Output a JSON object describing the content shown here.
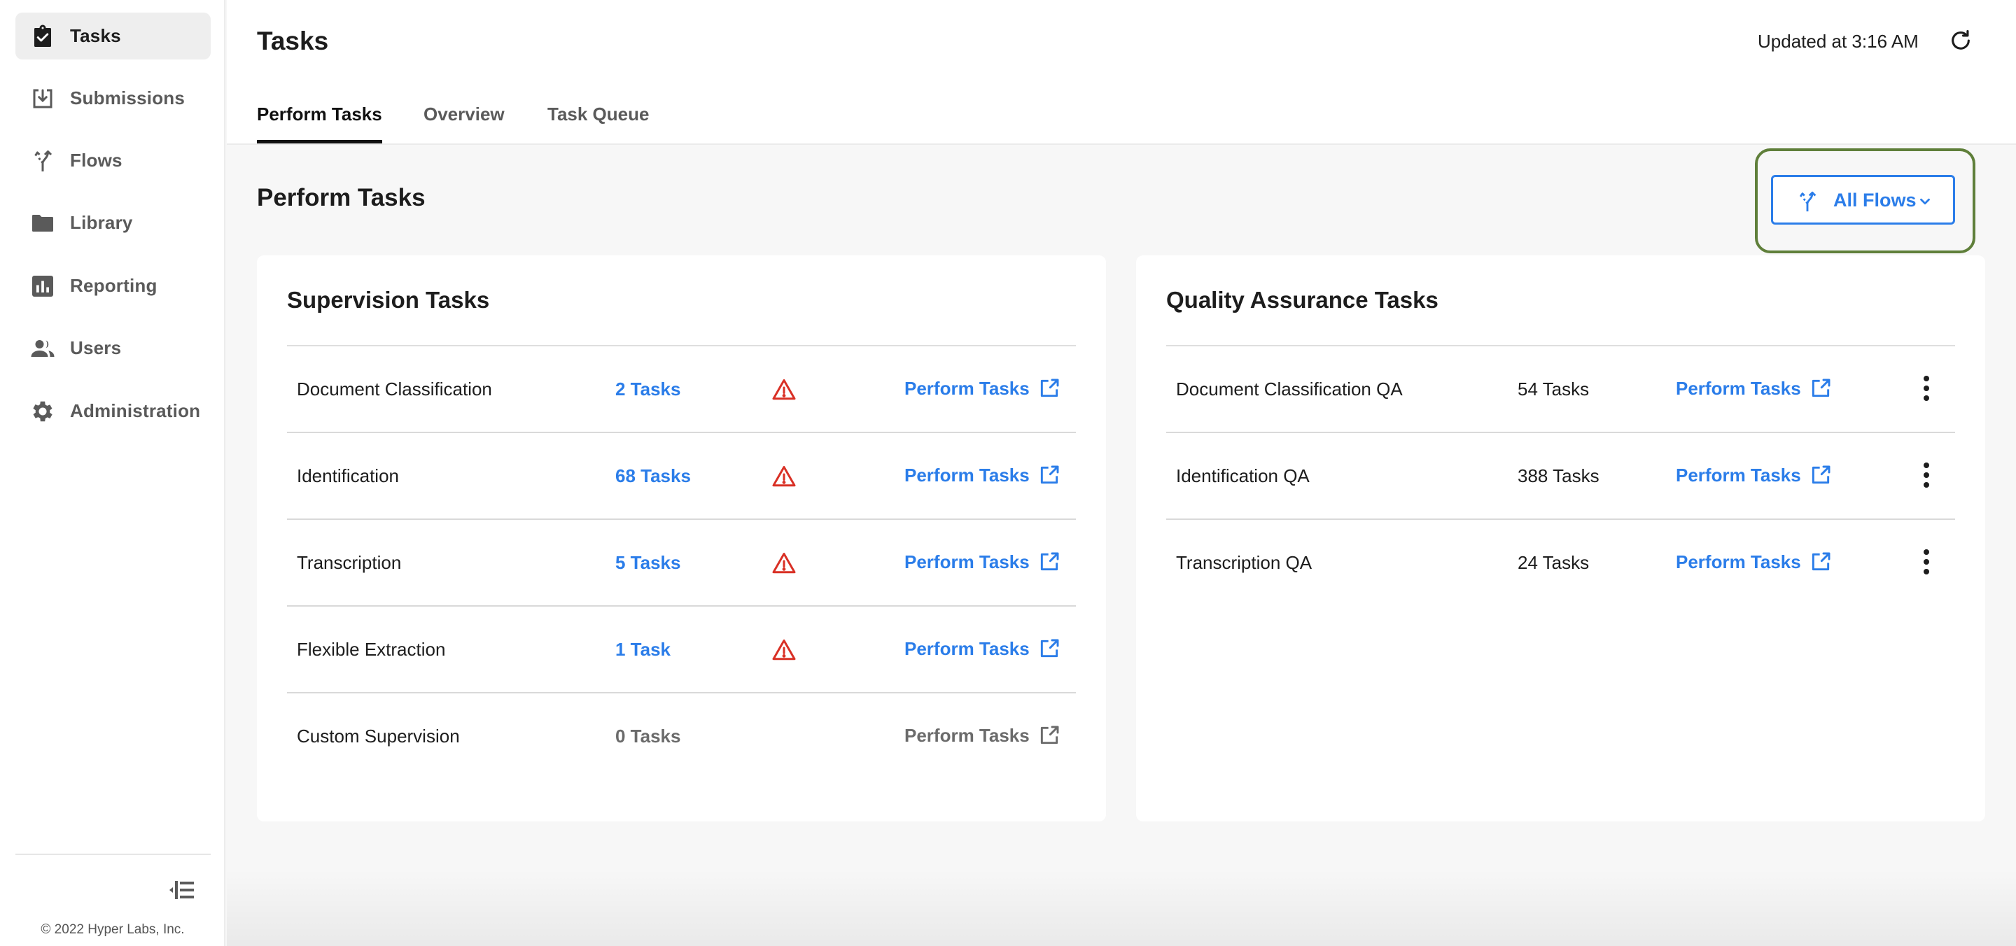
{
  "sidebar": {
    "items": [
      {
        "label": "Tasks",
        "icon": "clipboard-check-icon",
        "active": true
      },
      {
        "label": "Submissions",
        "icon": "inbox-download-icon",
        "active": false
      },
      {
        "label": "Flows",
        "icon": "flow-split-icon",
        "active": false
      },
      {
        "label": "Library",
        "icon": "folder-icon",
        "active": false
      },
      {
        "label": "Reporting",
        "icon": "bar-chart-icon",
        "active": false
      },
      {
        "label": "Users",
        "icon": "users-icon",
        "active": false
      },
      {
        "label": "Administration",
        "icon": "gear-icon",
        "active": false
      }
    ],
    "collapse_icon": "collapse-sidebar-icon",
    "copyright": "© 2022 Hyper Labs, Inc."
  },
  "header": {
    "title": "Tasks",
    "updated_text": "Updated at 3:16 AM",
    "refresh_icon": "refresh-icon",
    "tabs": [
      {
        "label": "Perform Tasks",
        "active": true
      },
      {
        "label": "Overview",
        "active": false
      },
      {
        "label": "Task Queue",
        "active": false
      }
    ]
  },
  "main": {
    "section_title": "Perform Tasks",
    "flow_filter": {
      "label": "All Flows",
      "icon": "flow-split-icon",
      "chevron": "chevron-down-icon"
    },
    "colors": {
      "accent": "#2b7de9",
      "warning": "#d93025",
      "highlight": "#5f7f3a"
    },
    "supervision": {
      "title": "Supervision Tasks",
      "rows": [
        {
          "name": "Document Classification",
          "count": "2 Tasks",
          "warning": true,
          "action": "Perform Tasks",
          "enabled": true
        },
        {
          "name": "Identification",
          "count": "68 Tasks",
          "warning": true,
          "action": "Perform Tasks",
          "enabled": true
        },
        {
          "name": "Transcription",
          "count": "5 Tasks",
          "warning": true,
          "action": "Perform Tasks",
          "enabled": true
        },
        {
          "name": "Flexible Extraction",
          "count": "1 Task",
          "warning": true,
          "action": "Perform Tasks",
          "enabled": true
        },
        {
          "name": "Custom Supervision",
          "count": "0 Tasks",
          "warning": false,
          "action": "Perform Tasks",
          "enabled": false
        }
      ]
    },
    "qa": {
      "title": "Quality Assurance Tasks",
      "rows": [
        {
          "name": "Document Classification QA",
          "count": "54 Tasks",
          "action": "Perform Tasks"
        },
        {
          "name": "Identification QA",
          "count": "388 Tasks",
          "action": "Perform Tasks"
        },
        {
          "name": "Transcription QA",
          "count": "24 Tasks",
          "action": "Perform Tasks"
        }
      ]
    }
  }
}
